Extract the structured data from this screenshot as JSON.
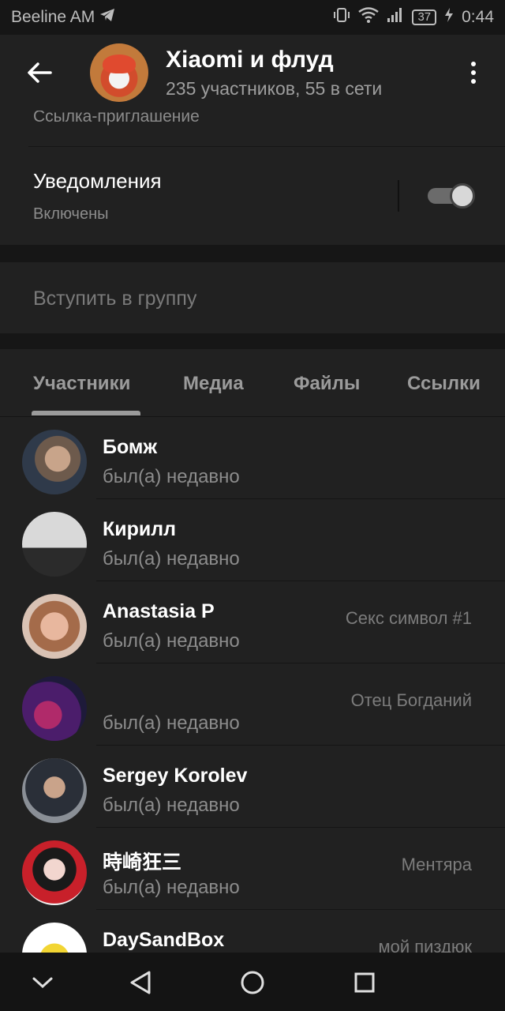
{
  "status_bar": {
    "carrier": "Beeline AM",
    "battery": "37",
    "time": "0:44",
    "icons": [
      "telegram-icon",
      "vibrate-icon",
      "wifi-icon",
      "signal-icon",
      "battery-icon",
      "charging-icon"
    ]
  },
  "header": {
    "title": "Xiaomi и флуд",
    "subtitle": "235 участников, 55 в сети",
    "back_icon": "arrow-left-icon",
    "menu_icon": "more-vert-icon"
  },
  "info": {
    "invite_link_label": "Ссылка-приглашение",
    "notifications_title": "Уведомления",
    "notifications_status": "Включены",
    "notifications_enabled": true
  },
  "join_button": "Вступить в группу",
  "tabs": [
    "Участники",
    "Медиа",
    "Файлы",
    "Ссылки"
  ],
  "active_tab": "Участники",
  "members": [
    {
      "name": "Бомж",
      "status": "был(а) недавно",
      "tag": ""
    },
    {
      "name": "Кирилл",
      "status": "был(а) недавно",
      "tag": ""
    },
    {
      "name": "Anastasia P",
      "status": "был(а) недавно",
      "tag": "Секс символ #1"
    },
    {
      "name": "",
      "status": "был(а) недавно",
      "tag": "Отец Богданий"
    },
    {
      "name": "Sergey Korolev",
      "status": "был(а) недавно",
      "tag": ""
    },
    {
      "name": "時崎狂三",
      "status": "был(а) недавно",
      "tag": "Ментяра"
    },
    {
      "name": "DaySandBox",
      "status": "",
      "tag": "мой пиздюк"
    }
  ],
  "nav": [
    "chevron-down-icon",
    "back-triangle-icon",
    "home-circle-icon",
    "recents-square-icon"
  ]
}
